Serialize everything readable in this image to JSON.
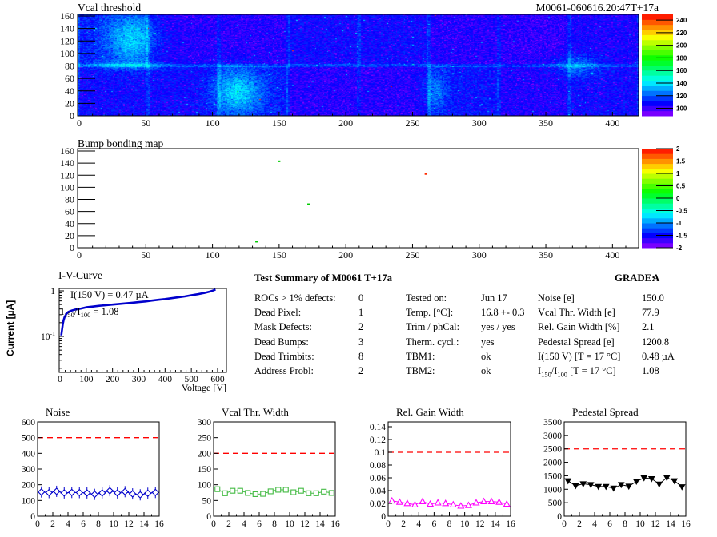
{
  "header": {
    "vcal_title": "Vcal threshold",
    "module_title": "M0061-060616.20:47T+17a",
    "bump_title": "Bump bonding map"
  },
  "summary": {
    "heading": "Test Summary of M0061",
    "variant": "T+17a",
    "grade_label": "GRADE:",
    "grade": "A",
    "rows": [
      {
        "c1l": "ROCs > 1% defects:",
        "c1v": "0",
        "c2l": "Tested on:",
        "c2v": "Jun 17",
        "c3l": "Noise [e]",
        "c3v": "150.0"
      },
      {
        "c1l": "Dead Pixel:",
        "c1v": "1",
        "c2l": "Temp. [°C]:",
        "c2v": "16.8 +- 0.3",
        "c3l": "Vcal Thr. Width [e]",
        "c3v": "77.9"
      },
      {
        "c1l": "Mask Defects:",
        "c1v": "2",
        "c2l": "Trim / phCal:",
        "c2v": "yes / yes",
        "c3l": "Rel. Gain Width [%]",
        "c3v": "2.1"
      },
      {
        "c1l": "Dead Bumps:",
        "c1v": "3",
        "c2l": "Therm. cycl.:",
        "c2v": "yes",
        "c3l": "Pedestal Spread [e]",
        "c3v": "1200.8"
      },
      {
        "c1l": "Dead Trimbits:",
        "c1v": "8",
        "c2l": "TBM1:",
        "c2v": "ok",
        "c3l": "I(150 V) [T = 17 °C]",
        "c3v": "0.48 µA"
      },
      {
        "c1l": "Address Probl:",
        "c1v": "2",
        "c2l": "TBM2:",
        "c2v": "ok",
        "c3l": "I_{150}/I_{100} [T = 17 °C]",
        "c3v": "1.08"
      }
    ]
  },
  "colors": {
    "ref_line": "#ff0000",
    "axis": "#000000",
    "iv_curve": "#0000cc",
    "noise_series": "#0000cc",
    "vcal_width_series": "#44bb44",
    "rel_gain_series": "#ff00ff",
    "pedestal_series": "#000000"
  },
  "chart_data": [
    {
      "id": "vcal_threshold_map",
      "type": "heatmap",
      "title": "Vcal threshold",
      "right_title": "M0061-060616.20:47T+17a",
      "xlim": [
        0,
        416
      ],
      "ylim": [
        0,
        160
      ],
      "xticks": [
        0,
        50,
        100,
        150,
        200,
        250,
        300,
        350,
        400
      ],
      "yticks": [
        0,
        20,
        40,
        60,
        80,
        100,
        120,
        140,
        160
      ],
      "colorbar": {
        "min": 88,
        "max": 249,
        "ticks": [
          100,
          120,
          140,
          160,
          180,
          200,
          220,
          240
        ]
      },
      "noise": {
        "seed": 987654321,
        "roc_grid": [
          8,
          2
        ],
        "roc_base": [
          [
            112,
            104,
            104,
            108,
            108,
            104,
            103,
            106
          ],
          [
            108,
            108,
            111,
            104,
            104,
            110,
            105,
            108
          ]
        ],
        "clouds": [
          [
            40,
            38,
            14,
            28,
            26
          ],
          [
            118,
            122,
            13,
            26,
            28
          ],
          [
            264,
            120,
            7,
            24,
            16
          ],
          [
            370,
            80,
            12,
            12,
            18
          ],
          [
            40,
            80,
            26,
            5,
            12
          ]
        ],
        "boundary_glow": 11,
        "edge_glow": 8,
        "purple_fraction": 0.05,
        "bright_fraction": 0.0035,
        "red_speck_count": 8
      }
    },
    {
      "id": "bump_bonding_map",
      "type": "heatmap",
      "title": "Bump bonding map",
      "xlim": [
        0,
        416
      ],
      "ylim": [
        0,
        160
      ],
      "xticks": [
        0,
        50,
        100,
        150,
        200,
        250,
        300,
        350,
        400
      ],
      "yticks": [
        0,
        20,
        40,
        60,
        80,
        100,
        120,
        140,
        160
      ],
      "colorbar": {
        "min": -2,
        "max": 2,
        "ticks": [
          2,
          1.5,
          1,
          0.5,
          0,
          -0.5,
          -1,
          -1.5,
          -2
        ]
      },
      "points": [
        {
          "x": 150,
          "y": 143,
          "color": "#00cc00"
        },
        {
          "x": 172,
          "y": 72,
          "color": "#00cc00"
        },
        {
          "x": 133,
          "y": 10,
          "color": "#00cc00"
        },
        {
          "x": 260,
          "y": 122,
          "color": "#ff2a00"
        }
      ]
    },
    {
      "id": "iv_curve",
      "type": "line",
      "title": "I-V-Curve",
      "xlabel": "Voltage [V]",
      "ylabel": "Current [µA]",
      "logy": true,
      "xlim": [
        0,
        630
      ],
      "ylim": [
        0.016,
        1.13
      ],
      "xticks": [
        0,
        100,
        200,
        300,
        400,
        500,
        600
      ],
      "ytick_labels": [
        {
          "v": 1,
          "label": "1"
        },
        {
          "v": 0.1,
          "label": "10^{-1}"
        }
      ],
      "annotations": [
        "I(150 V) = 0.47 µA",
        "I_{150}/I_{100} =  1.08"
      ],
      "points": [
        [
          5,
          0.105
        ],
        [
          7,
          0.13
        ],
        [
          9,
          0.16
        ],
        [
          11,
          0.19
        ],
        [
          14,
          0.23
        ],
        [
          18,
          0.27
        ],
        [
          24,
          0.31
        ],
        [
          32,
          0.345
        ],
        [
          45,
          0.37
        ],
        [
          60,
          0.39
        ],
        [
          80,
          0.41
        ],
        [
          100,
          0.435
        ],
        [
          125,
          0.452
        ],
        [
          150,
          0.47
        ],
        [
          175,
          0.483
        ],
        [
          200,
          0.5
        ],
        [
          225,
          0.515
        ],
        [
          250,
          0.53
        ],
        [
          275,
          0.548
        ],
        [
          300,
          0.565
        ],
        [
          325,
          0.585
        ],
        [
          350,
          0.61
        ],
        [
          375,
          0.635
        ],
        [
          400,
          0.66
        ],
        [
          425,
          0.69
        ],
        [
          450,
          0.72
        ],
        [
          475,
          0.755
        ],
        [
          500,
          0.8
        ],
        [
          525,
          0.845
        ],
        [
          550,
          0.9
        ],
        [
          570,
          0.96
        ],
        [
          585,
          1.03
        ],
        [
          592,
          1.07
        ]
      ]
    },
    {
      "id": "noise",
      "type": "line",
      "title": "Noise",
      "marker": "diamond",
      "x_note": "ROC index + 0.5",
      "xlim": [
        0,
        16
      ],
      "ylim": [
        0,
        600
      ],
      "xticks": [
        0,
        2,
        4,
        6,
        8,
        10,
        12,
        14,
        16
      ],
      "yticks": [
        0,
        100,
        200,
        300,
        400,
        500,
        600
      ],
      "ref_line": 500,
      "yerr": 35,
      "xerr": 0.5,
      "values": [
        154,
        150,
        158,
        148,
        151,
        150,
        148,
        139,
        148,
        162,
        148,
        156,
        142,
        136,
        146,
        151
      ]
    },
    {
      "id": "vcal_thr_width",
      "type": "line",
      "title": "Vcal Thr. Width",
      "marker": "square",
      "xlim": [
        0,
        16
      ],
      "ylim": [
        0,
        300
      ],
      "xticks": [
        0,
        2,
        4,
        6,
        8,
        10,
        12,
        14,
        16
      ],
      "yticks": [
        0,
        50,
        100,
        150,
        200,
        250,
        300
      ],
      "ref_line": 200,
      "values": [
        86,
        73,
        81,
        81,
        74,
        70,
        71,
        79,
        84,
        84,
        76,
        81,
        73,
        73,
        78,
        74
      ]
    },
    {
      "id": "rel_gain_width",
      "type": "line",
      "title": "Rel. Gain Width",
      "marker": "triangle-up",
      "xlim": [
        0,
        16
      ],
      "ylim": [
        0,
        0.1475
      ],
      "xticks": [
        0,
        2,
        4,
        6,
        8,
        10,
        12,
        14,
        16
      ],
      "yticks": [
        0,
        0.02,
        0.04,
        0.06,
        0.08,
        0.1,
        0.12,
        0.14
      ],
      "ref_line": 0.1,
      "values": [
        0.024,
        0.022,
        0.02,
        0.018,
        0.023,
        0.019,
        0.021,
        0.02,
        0.018,
        0.016,
        0.017,
        0.021,
        0.023,
        0.023,
        0.022,
        0.019
      ]
    },
    {
      "id": "pedestal_spread",
      "type": "line",
      "title": "Pedestal Spread",
      "marker": "triangle-down-filled",
      "xlim": [
        0,
        16
      ],
      "ylim": [
        0,
        3500
      ],
      "xticks": [
        0,
        2,
        4,
        6,
        8,
        10,
        12,
        14,
        16
      ],
      "yticks": [
        0,
        500,
        1000,
        1500,
        2000,
        2500,
        3000,
        3500
      ],
      "ref_line": 2500,
      "values": [
        1310,
        1130,
        1200,
        1170,
        1100,
        1100,
        1040,
        1170,
        1110,
        1290,
        1420,
        1390,
        1190,
        1430,
        1310,
        1090
      ]
    }
  ]
}
